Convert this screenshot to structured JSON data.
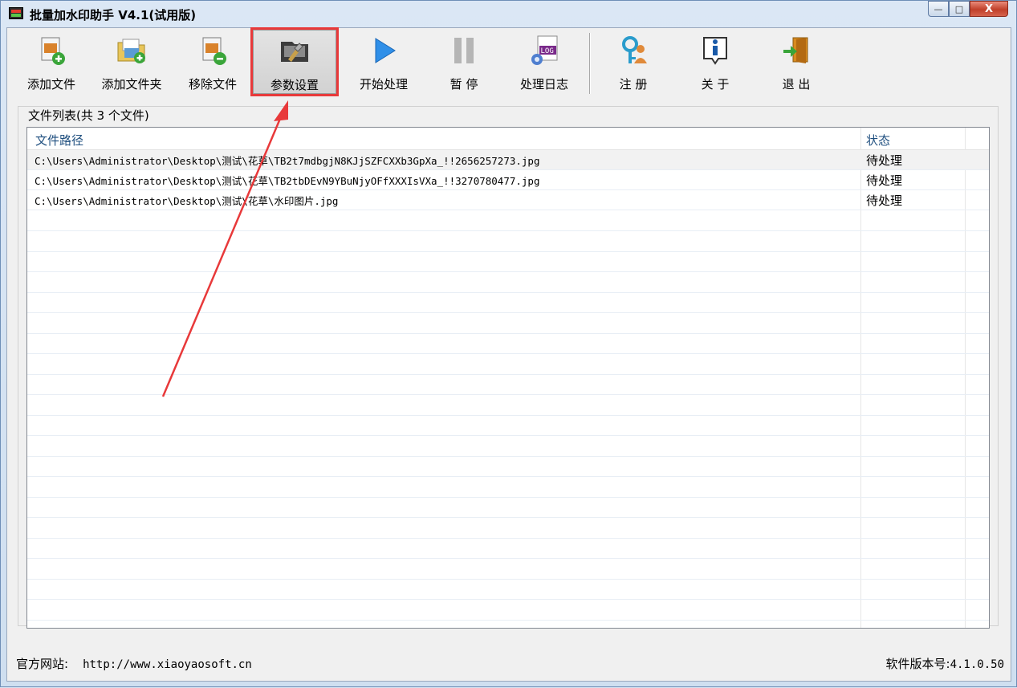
{
  "window": {
    "title": "批量加水印助手 V4.1(试用版)",
    "controls": {
      "minimize": "—",
      "maximize": "□",
      "close": "X"
    }
  },
  "toolbar": {
    "items": [
      {
        "label": "添加文件",
        "icon": "add-file-icon"
      },
      {
        "label": "添加文件夹",
        "icon": "add-folder-icon"
      },
      {
        "label": "移除文件",
        "icon": "remove-file-icon"
      },
      {
        "label": "参数设置",
        "icon": "settings-icon"
      },
      {
        "label": "开始处理",
        "icon": "play-icon"
      },
      {
        "label": "暂 停",
        "icon": "pause-icon"
      },
      {
        "label": "处理日志",
        "icon": "log-icon"
      },
      {
        "label": "注 册",
        "icon": "key-icon"
      },
      {
        "label": "关 于",
        "icon": "info-icon"
      },
      {
        "label": "退 出",
        "icon": "exit-door-icon"
      }
    ],
    "pressed_index": 3
  },
  "file_list": {
    "group_label": "文件列表(共 3 个文件)",
    "columns": [
      "文件路径",
      "状态"
    ],
    "rows": [
      {
        "path": "C:\\Users\\Administrator\\Desktop\\测试\\花草\\TB2t7mdbgjN8KJjSZFCXXb3GpXa_!!2656257273.jpg",
        "status": "待处理"
      },
      {
        "path": "C:\\Users\\Administrator\\Desktop\\测试\\花草\\TB2tbDEvN9YBuNjyOFfXXXIsVXa_!!3270780477.jpg",
        "status": "待处理"
      },
      {
        "path": "C:\\Users\\Administrator\\Desktop\\测试\\花草\\水印图片.jpg",
        "status": "待处理"
      }
    ]
  },
  "footer": {
    "website_label": "官方网站:",
    "website_url": "http://www.xiaoyaosoft.cn",
    "version_label": "软件版本号:",
    "version": "4.1.0.50"
  },
  "colors": {
    "highlight_box": "#e8393a",
    "annotation_arrow": "#e8393a",
    "header_text": "#1f4f7f"
  }
}
